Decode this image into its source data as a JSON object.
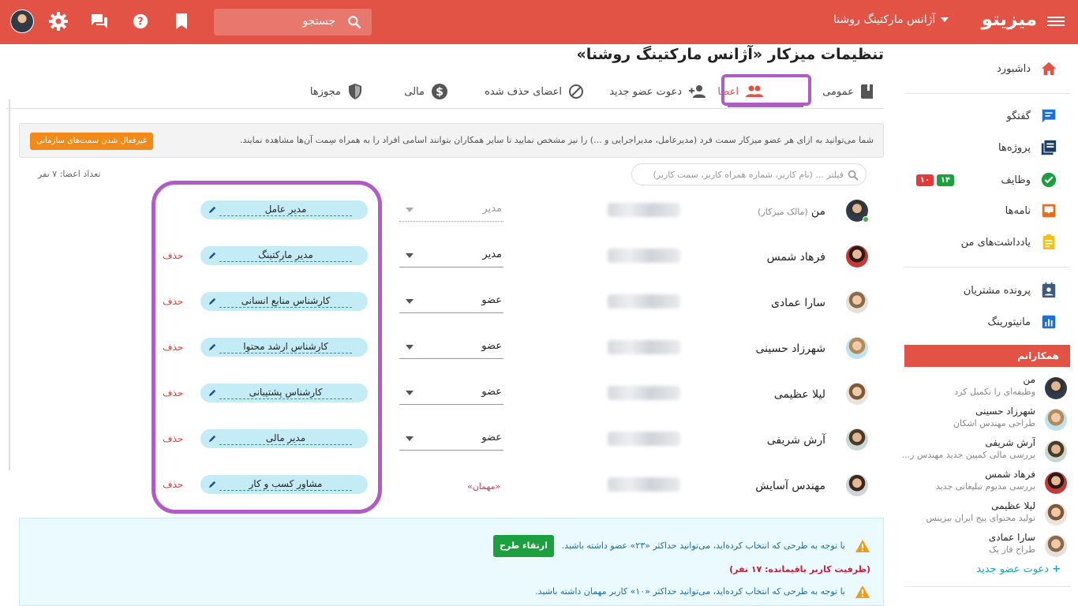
{
  "topbar": {
    "logo": "میزیتو",
    "organization": "آژانس مارکتینگ روشنا",
    "search_placeholder": "جستجو",
    "icons": [
      "menu-icon",
      "search-icon",
      "bookmark-icon",
      "help-icon",
      "chat-icon",
      "settings-icon",
      "avatar"
    ],
    "color": "#e25245"
  },
  "sidebar": {
    "items": [
      {
        "label": "داشبورد",
        "icon": "home-icon",
        "color": "#e25245"
      },
      {
        "label": "گفتگو",
        "icon": "chat-icon",
        "color": "#1e6fd6"
      },
      {
        "label": "پروژه‌ها",
        "icon": "projects-icon",
        "color": "#1b3e66"
      },
      {
        "label": "وظایف",
        "icon": "tasks-icon",
        "color": "#1c9f3e"
      },
      {
        "label": "نامه‌ها",
        "icon": "mail-icon",
        "color": "#f06a1a"
      },
      {
        "label": "یادداشت‌های من",
        "icon": "notes-icon",
        "color": "#f4c20d"
      },
      {
        "label": "پرونده مشتریان",
        "icon": "clients-icon",
        "color": "#3c5a7a"
      },
      {
        "label": "مانیتورینگ",
        "icon": "monitoring-icon",
        "color": "#1e6fd6"
      }
    ],
    "task_badges": {
      "green": "۱۴",
      "red": "۱۰"
    },
    "colleagues_header": "همکارانم",
    "colleagues": [
      {
        "name": "من",
        "sub": "وظیفه‌ای را تکمیل کرد"
      },
      {
        "name": "شهرزاد حسینی",
        "sub": "طراحی مهندس اشکان"
      },
      {
        "name": "آرش شریفی",
        "sub": "بررسی مالی کمپین جدید مهندس ز..."
      },
      {
        "name": "فرهاد شمس",
        "sub": "بررسی مدیوم تبلیغاتی جدید"
      },
      {
        "name": "لیلا عظیمی",
        "sub": "تولید محتوای پیج ایران بیزینس"
      },
      {
        "name": "سارا عمادی",
        "sub": "طراح فاز یک"
      }
    ],
    "invite_label": "دعوت عضو جدید"
  },
  "main": {
    "title": "تنظیمات میزکار «آژانس مارکتینگ روشنا»",
    "tabs": [
      {
        "label": "عمومی",
        "icon": "book-icon"
      },
      {
        "label": "اعضا",
        "icon": "users-icon",
        "active": true
      },
      {
        "label": "دعوت عضو جدید",
        "icon": "add-user-icon"
      },
      {
        "label": "اعضای حذف شده",
        "icon": "block-icon"
      },
      {
        "label": "مالی",
        "icon": "dollar-icon"
      },
      {
        "label": "مجوزها",
        "icon": "shield-icon"
      }
    ],
    "info_text": "شما می‌توانید به ازای هر عضو میزکار سمت فرد (مدیرعامل، مدیراجرایی و ...) را نیز مشخص نمایید تا سایر همکاران بتوانند اسامی افراد را به همراه سِمت آن‌ها مشاهده نمایند.",
    "info_button": "غیرفعال شدن سمت‌های سازمانی",
    "filter_placeholder": "فیلتر ... (نام کاربر، شماره همراه کاربر، سمت کاربر)",
    "member_count": "تعداد اعضا: ۷ نفر",
    "members": [
      {
        "name": "من",
        "owner": "(مالک میزکار)",
        "role": "مدیر",
        "position": "مدیر عامل",
        "delete": ""
      },
      {
        "name": "فرهاد شمس",
        "owner": "",
        "role": "مدیر",
        "position": "مدیر مارکتینگ",
        "delete": "حذف"
      },
      {
        "name": "سارا عمادی",
        "owner": "",
        "role": "عضو",
        "position": "کارشناس منابع انسانی",
        "delete": "حذف"
      },
      {
        "name": "شهرزاد حسینی",
        "owner": "",
        "role": "عضو",
        "position": "کارشناس ارشد محتوا",
        "delete": "حذف"
      },
      {
        "name": "لیلا عظیمی",
        "owner": "",
        "role": "عضو",
        "position": "کارشناس پشتیبانی",
        "delete": "حذف"
      },
      {
        "name": "آرش شریفی",
        "owner": "",
        "role": "عضو",
        "position": "مدیر مالی",
        "delete": "حذف"
      },
      {
        "name": "مهندس آسایش",
        "owner": "",
        "role": "«مهمان»",
        "position": "مشاور کسب و کار",
        "delete": "حذف"
      }
    ],
    "plan": {
      "line1": "با توجه به طرحی که انتخاب کرده‌اید، می‌توانید حداکثر «۲۳» عضو داشته باشید.",
      "upgrade_button": "ارتقاء طرح",
      "remaining": "(ظرفیت کاربر باقیمانده: ۱۷ نفر)",
      "line2": "با توجه به طرحی که انتخاب کرده‌اید، می‌توانید حداکثر «۱۰» کاربر مهمان داشته باشید."
    }
  }
}
